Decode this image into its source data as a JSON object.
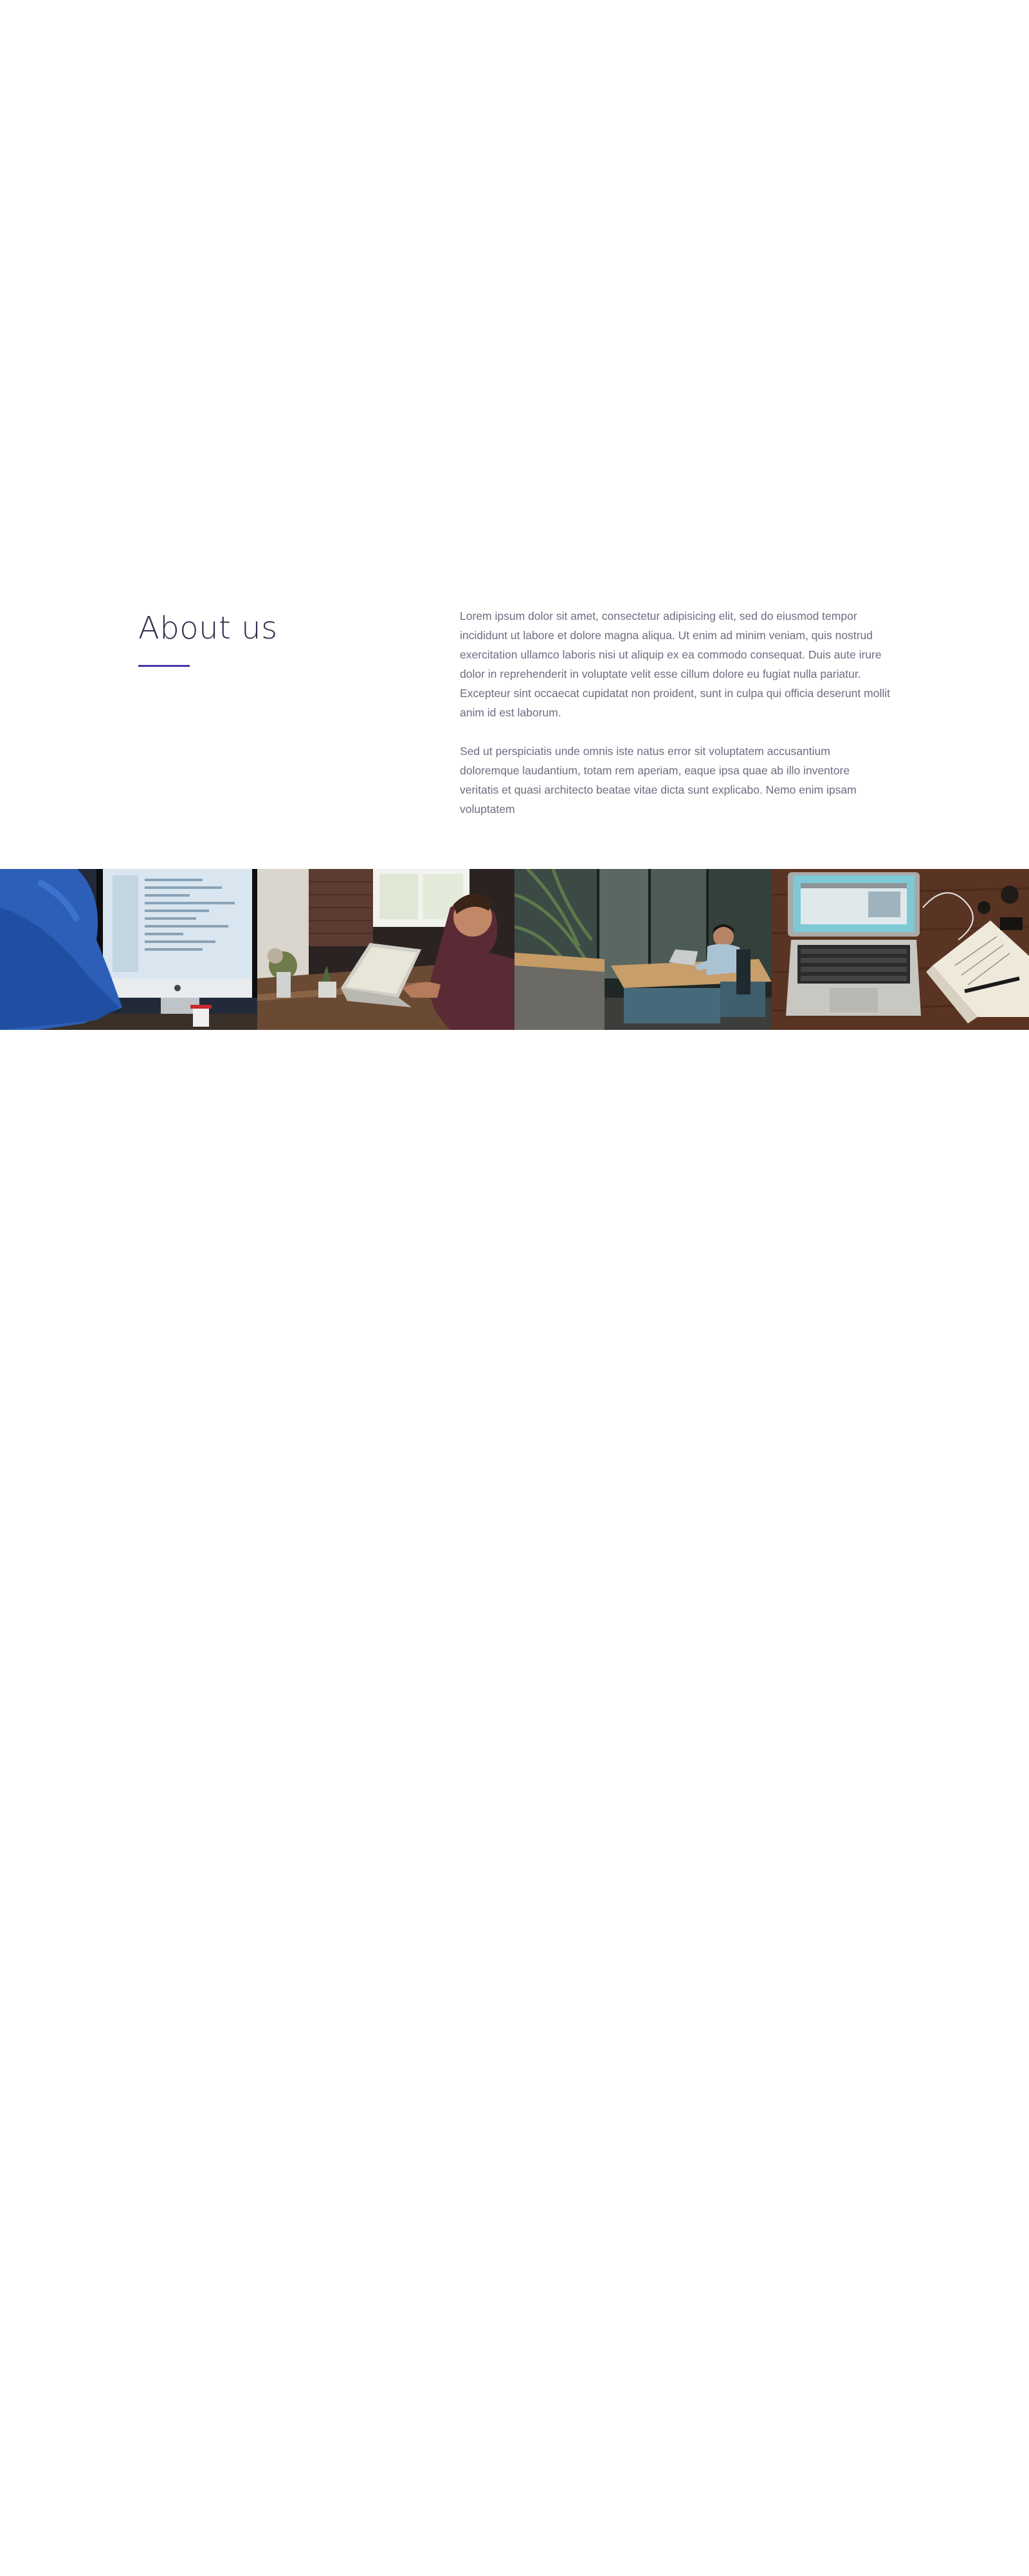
{
  "about": {
    "title": "About us",
    "accent_color": "#4338a8",
    "paragraphs": [
      "Lorem ipsum dolor sit amet, consectetur adipisicing elit, sed do eiusmod tempor incididunt ut labore et dolore magna aliqua. Ut enim ad minim veniam, quis nostrud exercitation ullamco laboris nisi ut aliquip ex ea commodo consequat. Duis aute irure dolor in reprehenderit in voluptate velit esse cillum dolore eu fugiat nulla pariatur. Excepteur sint occaecat cupidatat non proident, sunt in culpa qui officia deserunt mollit anim id est laborum.",
      "Sed ut perspiciatis unde omnis iste natus error sit voluptatem accusantium doloremque laudantium, totam rem aperiam, eaque ipsa quae ab illo inventore veritatis et quasi architecto beatae vitae dicta sunt explicabo. Nemo enim ipsam voluptatem"
    ]
  },
  "gallery": {
    "images": [
      {
        "subject": "person at desktop computer"
      },
      {
        "subject": "person typing on laptop"
      },
      {
        "subject": "person working in office"
      },
      {
        "subject": "laptop and notebook on desk"
      }
    ]
  }
}
